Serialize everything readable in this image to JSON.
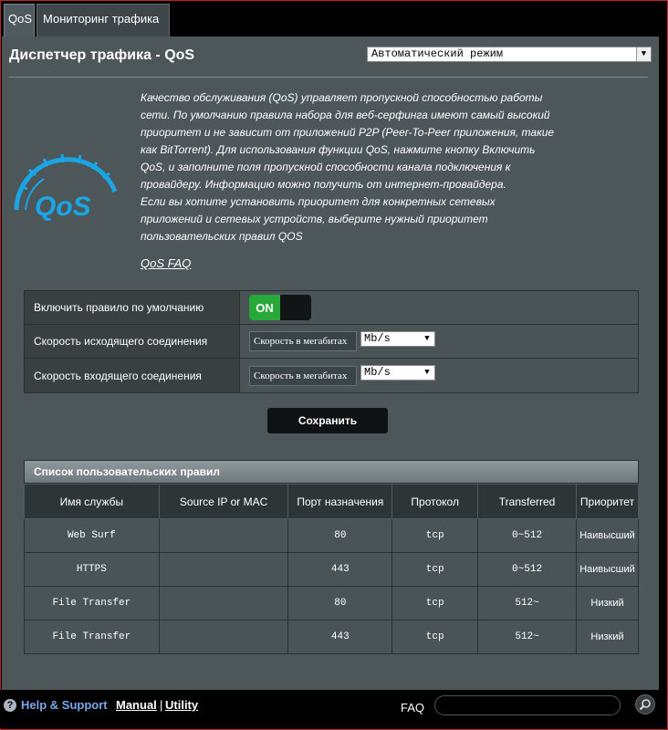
{
  "tabs": [
    {
      "label": "QoS",
      "active": true
    },
    {
      "label": "Мониторинг трафика",
      "active": false
    }
  ],
  "header": {
    "title": "Диспетчер трафика - QoS",
    "mode_value": "Автоматический режим"
  },
  "logo": {
    "text": "QoS",
    "icon": "speedometer-logo"
  },
  "description": {
    "lines": [
      "Качество обслуживания (QoS) управляет пропускной способностью работы",
      "сети. По умолчанию правила набора для веб-серфинга имеют самый высокий",
      "приоритет и не зависит от приложений P2P (Peer-To-Peer приложения, такие",
      "как BitTorrent). Для использования функции QoS, нажмите кнопку Включить",
      "QoS, и заполните поля пропускной способности канала подключения к",
      "провайдеру. Информацию можно получить от интернет-провайдера.",
      "Если вы хотите установить приоритет для конкретных сетевых",
      "приложений и сетевых устройств, выберите нужный приоритет",
      "пользовательских правил QOS"
    ],
    "faq_link": "QoS FAQ"
  },
  "settings": {
    "enable_label": "Включить правило по умолчанию",
    "toggle_state": "ON",
    "upload_label": "Скорость исходящего соединения",
    "upload_placeholder": "Скорость в мегабитах",
    "upload_unit": "Mb/s",
    "download_label": "Скорость входящего соединения",
    "download_placeholder": "Скорость в мегабитах",
    "download_unit": "Mb/s"
  },
  "save_label": "Сохранить",
  "rules": {
    "title": "Список пользовательских правил",
    "columns": [
      "Имя службы",
      "Source IP or MAC",
      "Порт назначения",
      "Протокол",
      "Transferred",
      "Приоритет"
    ],
    "rows": [
      [
        "Web Surf",
        "",
        "80",
        "tcp",
        "0~512",
        "Наивысший"
      ],
      [
        "HTTPS",
        "",
        "443",
        "tcp",
        "0~512",
        "Наивысший"
      ],
      [
        "File Transfer",
        "",
        "80",
        "tcp",
        "512~",
        "Низкий"
      ],
      [
        "File Transfer",
        "",
        "443",
        "tcp",
        "512~",
        "Низкий"
      ]
    ]
  },
  "footer": {
    "help": "Help & Support",
    "manual": "Manual",
    "separator": "|",
    "utility": "Utility",
    "faq": "FAQ"
  },
  "colors": {
    "panel": "#4d5659",
    "accent_blue": "#1aa6e4",
    "toggle_on": "#27a838",
    "help_link": "#7aa7ea"
  }
}
